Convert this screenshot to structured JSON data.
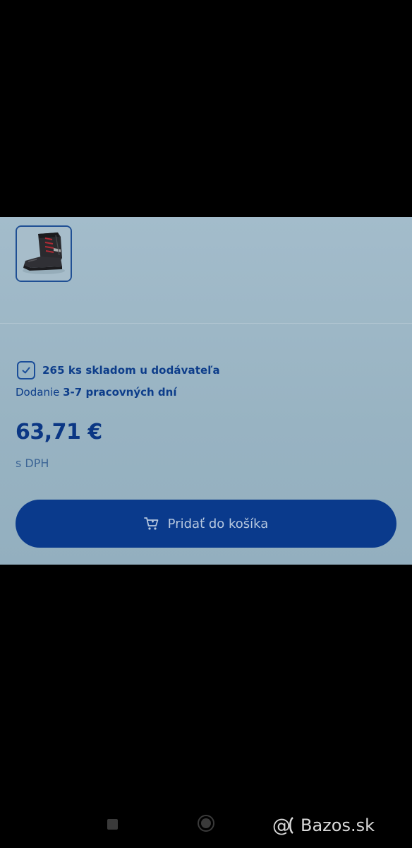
{
  "product": {
    "thumbnail_alt": "Pracovná obuv",
    "stock_text": "265 ks skladom u dodávateľa",
    "delivery_prefix": "Dodanie",
    "delivery_days": "3-7 pracovných dní",
    "price": "63,71 €",
    "vat_note": "s DPH",
    "add_to_cart_label": "Pridať do košíka"
  },
  "watermark": {
    "text": "Bazos.sk"
  },
  "colors": {
    "accent": "#0a3a8c",
    "text_primary": "#0d3d8a",
    "panel_background": "#9fb9c8"
  }
}
